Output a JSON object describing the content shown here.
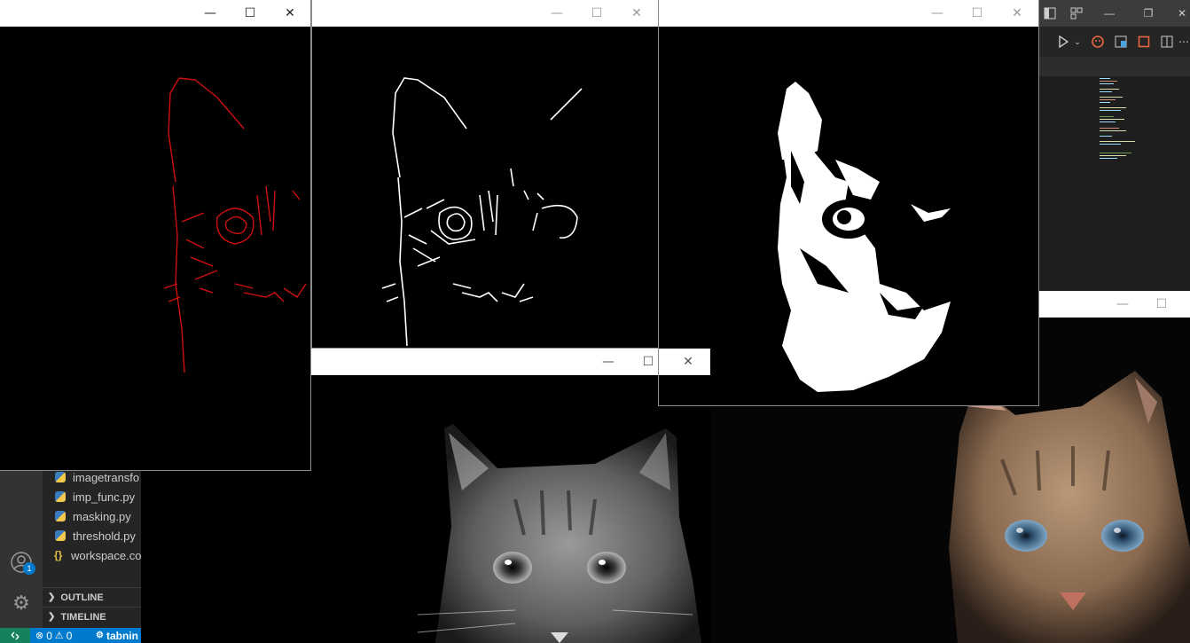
{
  "explorer": {
    "files": [
      {
        "name": "imagetransfo",
        "icon": "python-file-icon"
      },
      {
        "name": "imp_func.py",
        "icon": "python-file-icon"
      },
      {
        "name": "masking.py",
        "icon": "python-file-icon"
      },
      {
        "name": "threshold.py",
        "icon": "python-file-icon"
      },
      {
        "name": "workspace.co",
        "icon": "json-file-icon"
      }
    ],
    "sections": [
      {
        "label": "OUTLINE"
      },
      {
        "label": "TIMELINE"
      }
    ]
  },
  "activity": {
    "accounts_badge": "1"
  },
  "statusbar": {
    "remote_icon": "remote-icon",
    "errors": "0",
    "warnings": "0",
    "extension": "tabnin"
  },
  "windows": {
    "controls": {
      "minimize": "—",
      "maximize": "☐",
      "close": "✕"
    }
  },
  "colors": {
    "edge_red": "#d01010",
    "edge_white": "#ffffff",
    "vscode_blue": "#007acc",
    "remote_green": "#16825d"
  }
}
